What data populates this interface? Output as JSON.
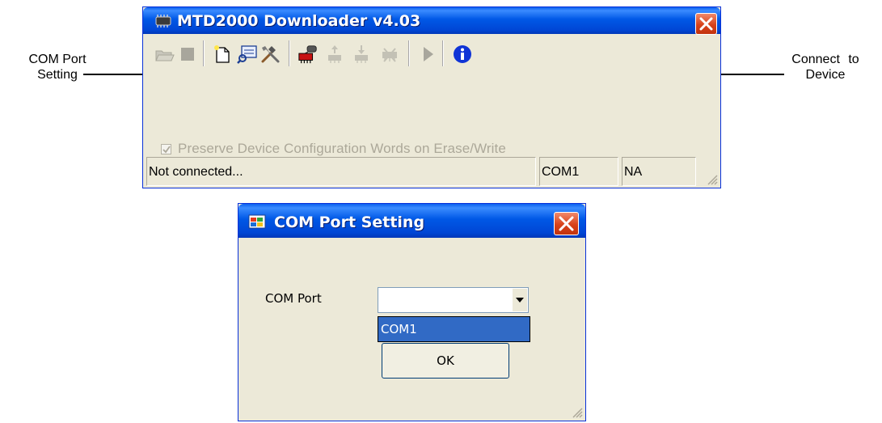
{
  "annotations": {
    "com_port_setting": "COM Port\nSetting",
    "connect_to_device": "Connect to\nDevice"
  },
  "main_window": {
    "title": "MTD2000 Downloader v4.03",
    "toolbar": [
      "open-icon",
      "stop-icon",
      "new-file-icon",
      "browse-icon",
      "tools-icon",
      "connect-device-icon",
      "read-icon",
      "write-icon",
      "erase-icon",
      "run-icon",
      "info-icon"
    ],
    "checkbox": {
      "label": "Preserve Device Configuration Words on Erase/Write",
      "checked": true,
      "enabled": false
    },
    "status": {
      "connection": "Not connected...",
      "port": "COM1",
      "device": "NA"
    }
  },
  "dialog": {
    "title": "COM Port Setting",
    "com_port_label": "COM Port",
    "combo_value": "",
    "dropdown_options": [
      "COM1"
    ],
    "ok_label": "OK"
  },
  "colors": {
    "title_bar": "#0058e6",
    "close_button": "#d8421a",
    "window_face": "#ece9d8",
    "selection": "#316ac5",
    "info_icon": "#1034d6"
  }
}
